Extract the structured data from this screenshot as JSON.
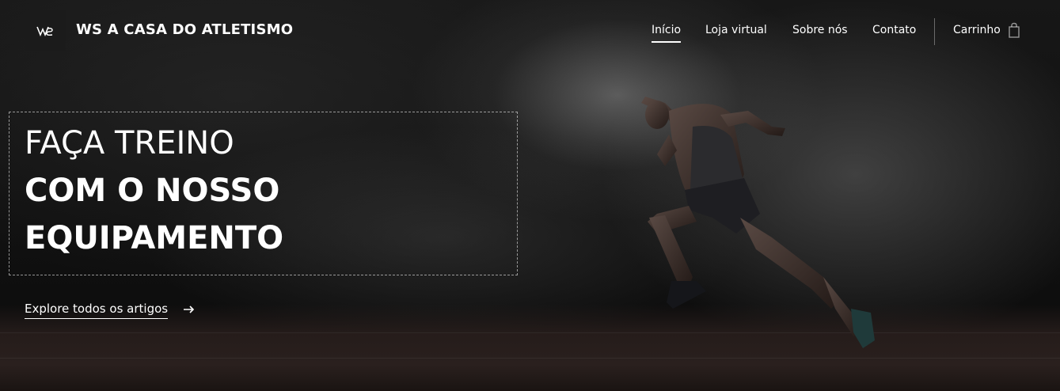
{
  "brand": {
    "logo_icon": "ws-monogram-icon",
    "name": "WS A CASA DO ATLETISMO"
  },
  "nav": {
    "items": [
      {
        "label": "Início",
        "active": true
      },
      {
        "label": "Loja virtual",
        "active": false
      },
      {
        "label": "Sobre nós",
        "active": false
      },
      {
        "label": "Contato",
        "active": false
      }
    ],
    "cart": {
      "label": "Carrinho",
      "icon": "shopping-bag-icon"
    }
  },
  "hero": {
    "headline_line1": "FAÇA TREINO",
    "headline_line2": "COM O NOSSO",
    "headline_line3": "EQUIPAMENTO",
    "cta_label": "Explore todos os artigos",
    "cta_icon": "arrow-right-icon",
    "image": "sprinter-running-in-smoke-image"
  },
  "colors": {
    "text": "#ffffff",
    "background": "#0b0b0b",
    "logo_box": "#1b1b1b"
  }
}
